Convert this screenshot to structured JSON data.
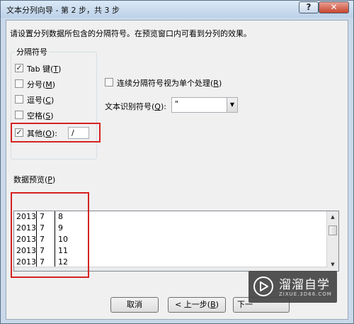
{
  "window": {
    "title": "文本分列向导 - 第 2 步，共 3 步",
    "help_glyph": "?",
    "close_glyph": "✕"
  },
  "instruction": "请设置分列数据所包含的分隔符号。在预览窗口内可看到分列的效果。",
  "delimiters": {
    "group_label": "分隔符号",
    "tab": {
      "pre": "Tab 键(",
      "key": "T",
      "post": ")",
      "checked": true
    },
    "semicolon": {
      "pre": "分号(",
      "key": "M",
      "post": ")",
      "checked": false
    },
    "comma": {
      "pre": "逗号(",
      "key": "C",
      "post": ")",
      "checked": false
    },
    "space": {
      "pre": "空格(",
      "key": "S",
      "post": ")",
      "checked": false
    },
    "other": {
      "pre": "其他(",
      "key": "O",
      "post": "):",
      "checked": true,
      "value": "/"
    }
  },
  "consecutive": {
    "pre": "连续分隔符号视为单个处理(",
    "key": "R",
    "post": ")",
    "checked": false
  },
  "text_qualifier": {
    "pre": "文本识别符号(",
    "key": "Q",
    "post": "):",
    "value": "\""
  },
  "preview": {
    "label_pre": "数据预览(",
    "label_key": "P",
    "label_post": ")",
    "rows": [
      [
        "2013",
        "7",
        "8"
      ],
      [
        "2013",
        "7",
        "9"
      ],
      [
        "2013",
        "7",
        "10"
      ],
      [
        "2013",
        "7",
        "11"
      ],
      [
        "2013",
        "7",
        "12"
      ]
    ]
  },
  "buttons": {
    "cancel": "取消",
    "back_pre": "< 上一步(",
    "back_key": "B",
    "back_post": ")",
    "next": "下一"
  },
  "watermark": {
    "brand": "溜溜自学",
    "site": "ZIXUE.3D66.COM"
  },
  "colors": {
    "highlight_red": "#d62222"
  }
}
